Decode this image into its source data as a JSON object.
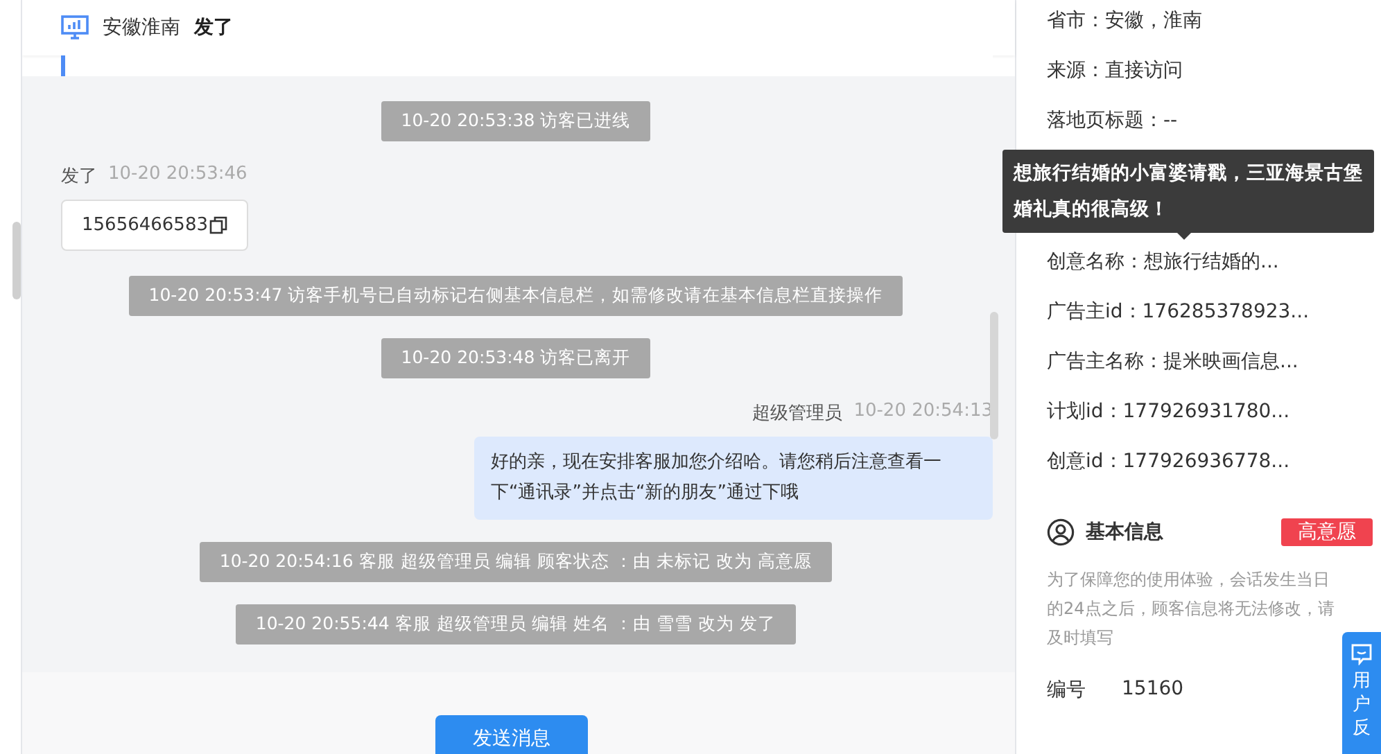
{
  "header": {
    "location": "安徽淮南",
    "name": "发了"
  },
  "messages": [
    {
      "kind": "system",
      "text": "10-20 20:53:38 访客已进线"
    },
    {
      "kind": "visitor",
      "sender": "发了",
      "time": "10-20 20:53:46",
      "text": "15656466583"
    },
    {
      "kind": "system",
      "text": "10-20 20:53:47 访客手机号已自动标记右侧基本信息栏，如需修改请在基本信息栏直接操作"
    },
    {
      "kind": "system",
      "text": "10-20 20:53:48 访客已离开"
    },
    {
      "kind": "agent",
      "sender": "超级管理员",
      "time": "10-20 20:54:13",
      "text": "好的亲，现在安排客服加您介绍哈。请您稍后注意查看一下“通讯录”并点击“新的朋友”通过下哦"
    },
    {
      "kind": "system",
      "text": "10-20 20:54:16 客服 超级管理员 编辑 顾客状态 ：由 未标记 改为 高意愿"
    },
    {
      "kind": "system",
      "text": "10-20 20:55:44 客服 超级管理员 编辑 姓名 ：由 雪雪 改为 发了"
    }
  ],
  "send_button": "发送消息",
  "info_rows": [
    {
      "kind": "row",
      "text": "省市：安徽，淮南"
    },
    {
      "kind": "row",
      "text": "来源：直接访问"
    },
    {
      "kind": "row",
      "text": "落地页标题：--"
    },
    {
      "kind": "tooltip",
      "text": "想旅行结婚的小富婆请戳，三亚海景古堡婚礼真的很高级！"
    },
    {
      "kind": "row",
      "text": "创意名称：想旅行结婚的..."
    },
    {
      "kind": "row",
      "text": "广告主id：176285378923..."
    },
    {
      "kind": "row",
      "text": "广告主名称：提米映画信息..."
    },
    {
      "kind": "row",
      "text": "计划id：177926931780..."
    },
    {
      "kind": "row",
      "text": "创意id：177926936778..."
    }
  ],
  "basic_info": {
    "title": "基本信息",
    "tag": "高意愿",
    "notice": "为了保障您的使用体验，会话发生当日的24点之后，顾客信息将无法修改，请及时填写",
    "fields": [
      {
        "label": "编号",
        "value": "15160"
      }
    ]
  },
  "feedback": "用户反"
}
